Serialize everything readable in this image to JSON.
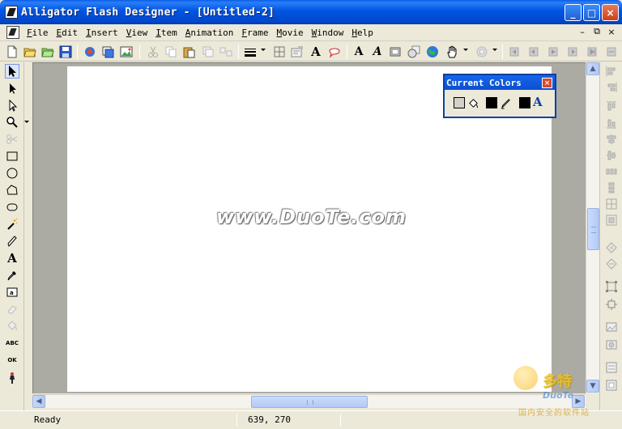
{
  "window": {
    "title": "Alligator Flash Designer - [Untitled-2]",
    "minimize": "_",
    "maximize": "□",
    "close": "×"
  },
  "menu": {
    "items": [
      {
        "label": "File",
        "accel": "F",
        "rest": "ile"
      },
      {
        "label": "Edit",
        "accel": "E",
        "rest": "dit"
      },
      {
        "label": "Insert",
        "accel": "I",
        "rest": "nsert"
      },
      {
        "label": "View",
        "accel": "V",
        "rest": "iew"
      },
      {
        "label": "Item",
        "accel": "I",
        "rest": "tem"
      },
      {
        "label": "Animation",
        "accel": "A",
        "rest": "nimation"
      },
      {
        "label": "Frame",
        "accel": "F",
        "rest": "rame"
      },
      {
        "label": "Movie",
        "accel": "M",
        "rest": "ovie"
      },
      {
        "label": "Window",
        "accel": "W",
        "rest": "indow"
      },
      {
        "label": "Help",
        "accel": "H",
        "rest": "elp"
      }
    ],
    "mdi_minimize": "–",
    "mdi_restore": "⧉",
    "mdi_close": "×"
  },
  "toolbar": {
    "text_tool_glyph": "A",
    "font_glyph_1": "A",
    "font_glyph_2": "A"
  },
  "lefttools": {
    "text_glyph": "A",
    "abc_label": "ABC",
    "ok_label": "OK"
  },
  "canvas": {
    "watermark": "www.DuoTe.com"
  },
  "palette": {
    "title": "Current Colors",
    "close": "×",
    "fill_swatch_color": "#d4d0c8",
    "line_swatch_color": "#000000",
    "text_swatch_color": "#000000",
    "text_icon": "A"
  },
  "status": {
    "message": "Ready",
    "coordinates": "639, 270"
  },
  "logo": {
    "chinese": "多特",
    "english": "DuoTe",
    "sub": "国内安全的软件站"
  }
}
